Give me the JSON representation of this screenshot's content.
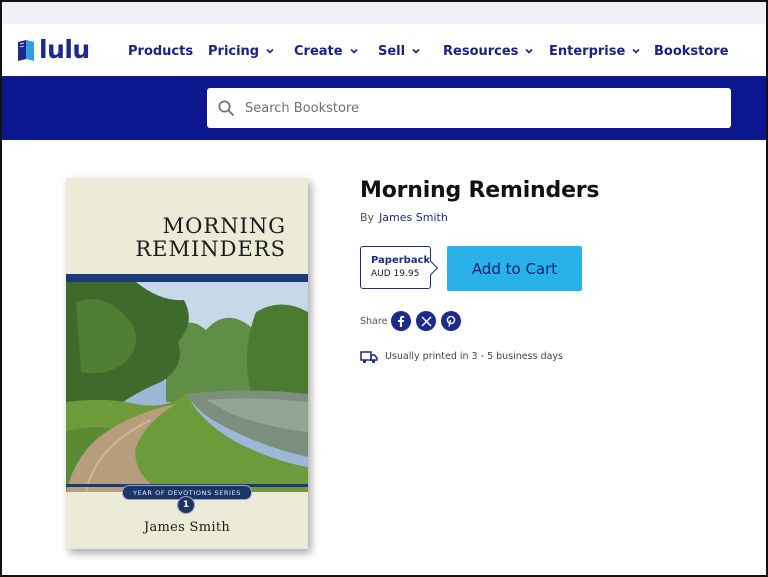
{
  "brand": {
    "name": "lulu",
    "color": "#1c2a8c"
  },
  "nav": {
    "items": [
      {
        "label": "Products",
        "dropdown": false
      },
      {
        "label": "Pricing",
        "dropdown": true
      },
      {
        "label": "Create",
        "dropdown": true
      },
      {
        "label": "Sell",
        "dropdown": true
      },
      {
        "label": "Resources",
        "dropdown": true
      },
      {
        "label": "Enterprise",
        "dropdown": true
      },
      {
        "label": "Bookstore",
        "dropdown": false
      }
    ]
  },
  "search": {
    "placeholder": "Search Bookstore",
    "icon": "search-icon",
    "band_color": "#0b168f"
  },
  "book": {
    "cover": {
      "title_line1": "MORNING",
      "title_line2": "REMINDERS",
      "series": "YEAR OF DEVOTIONS SERIES",
      "series_number": "1",
      "author": "James Smith"
    },
    "title": "Morning Reminders",
    "by_label": "By",
    "author": "James Smith",
    "format": {
      "name": "Paperback",
      "price": "AUD 19.95"
    },
    "add_to_cart": "Add to Cart",
    "share_label": "Share",
    "share_icons": [
      "facebook-icon",
      "x-icon",
      "pinterest-icon"
    ],
    "shipping_text": "Usually printed in 3 - 5 business days"
  },
  "colors": {
    "accent": "#29b2ea",
    "navy": "#1c2a8c"
  }
}
